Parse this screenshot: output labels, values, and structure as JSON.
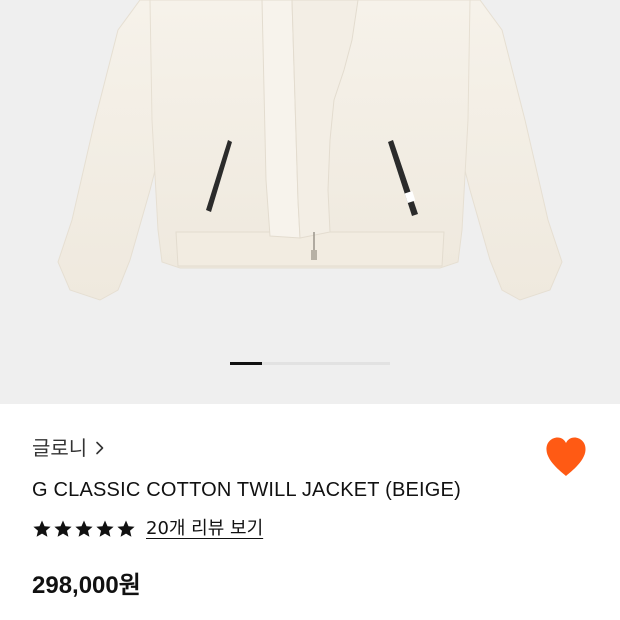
{
  "gallery": {
    "image_alt": "beige cotton twill jacket",
    "slide_indicator": {
      "active_index": 1,
      "total": 5
    }
  },
  "product": {
    "brand": "글로니",
    "brand_chevron_icon": "chevron-right-icon",
    "title": "G CLASSIC COTTON TWILL JACKET (BEIGE)",
    "rating_stars": 5,
    "review_link": "20개 리뷰 보기",
    "price": "298,000원",
    "wishlisted": true,
    "wishlist_icon": "heart-icon"
  },
  "colors": {
    "heart": "#ff5a14",
    "stars": "#111111",
    "gallery_bg": "#efefef",
    "jacket": "#f4efe5"
  }
}
